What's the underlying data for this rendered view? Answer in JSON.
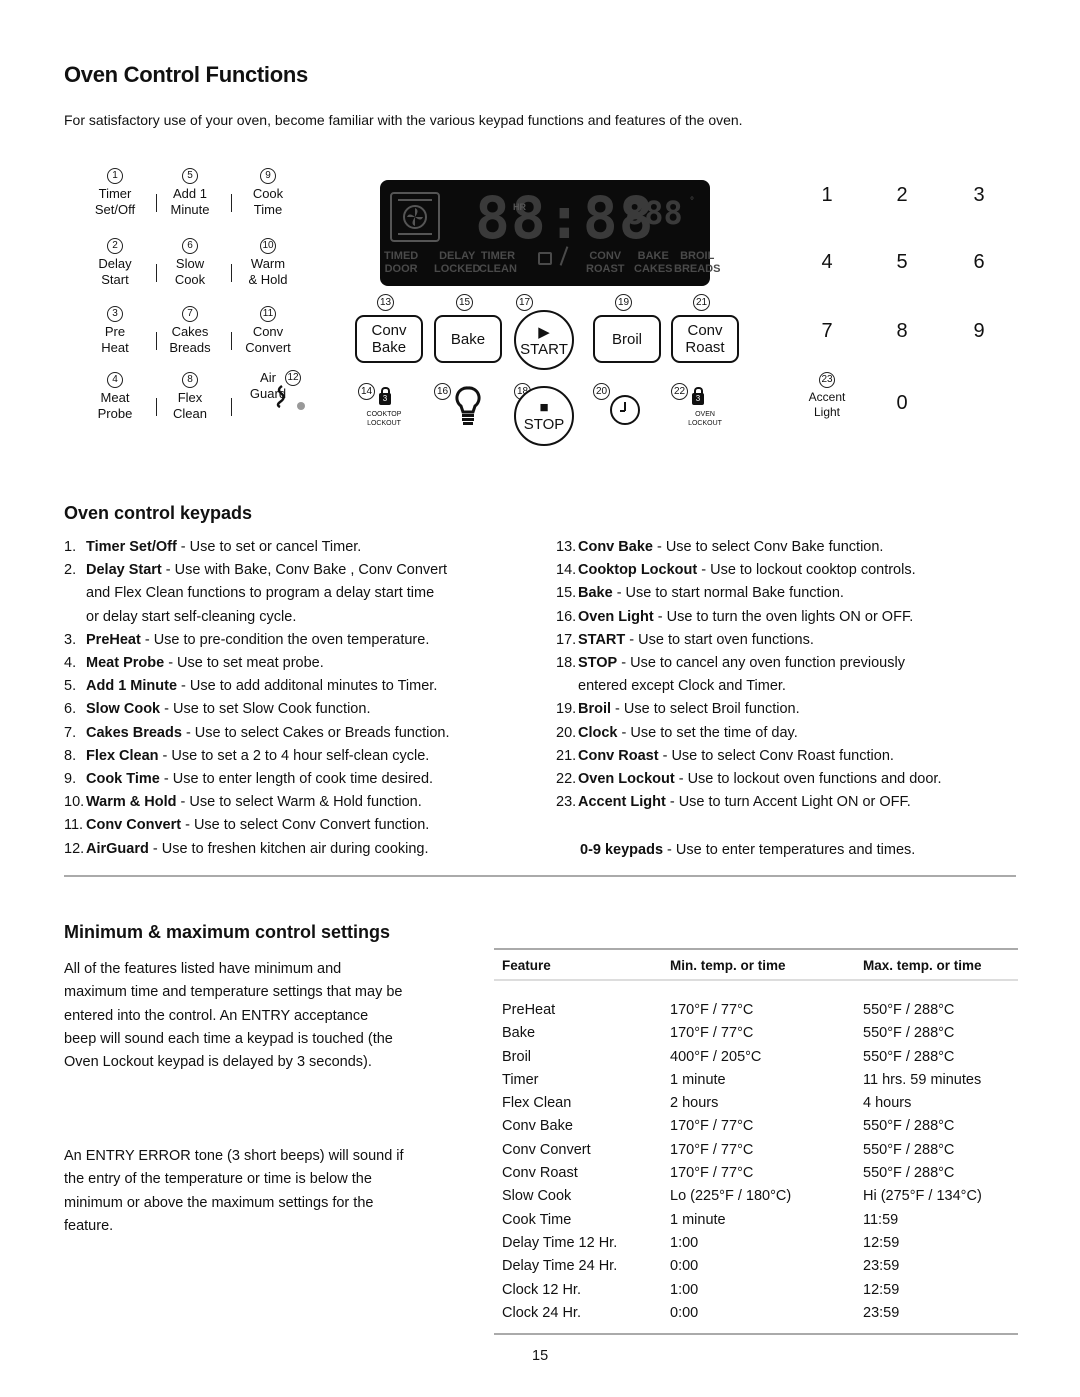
{
  "page": {
    "title": "Oven Control Functions",
    "intro": "For satisfactory use of your oven, become familiar with the various keypad functions and features of the oven.",
    "page_number": "15"
  },
  "panel": {
    "function_keys": [
      {
        "num": "1",
        "line1": "Timer",
        "line2": "Set/Off"
      },
      {
        "num": "5",
        "line1": "Add 1",
        "line2": "Minute"
      },
      {
        "num": "9",
        "line1": "Cook",
        "line2": "Time"
      },
      {
        "num": "2",
        "line1": "Delay",
        "line2": "Start"
      },
      {
        "num": "6",
        "line1": "Slow",
        "line2": "Cook"
      },
      {
        "num": "10",
        "line1": "Warm",
        "line2": "& Hold"
      },
      {
        "num": "3",
        "line1": "Pre",
        "line2": "Heat"
      },
      {
        "num": "7",
        "line1": "Cakes",
        "line2": "Breads"
      },
      {
        "num": "11",
        "line1": "Conv",
        "line2": "Convert"
      },
      {
        "num": "4",
        "line1": "Meat",
        "line2": "Probe"
      },
      {
        "num": "8",
        "line1": "Flex",
        "line2": "Clean"
      },
      {
        "num": "12",
        "line1": "Air",
        "line2": "Guard"
      }
    ],
    "display": {
      "clock_digits": "88:88",
      "hr_label": "HR",
      "temp_digits": "888",
      "degree": "°",
      "indicators_row1": [
        "TIMED",
        "DELAY",
        "TIMER",
        "CONV",
        "BAKE",
        "BROIL"
      ],
      "indicators_row2": [
        "DOOR",
        "LOCKED",
        "CLEAN",
        "ROAST",
        "CAKES",
        "BREADS"
      ]
    },
    "mode_buttons": [
      {
        "num": "13",
        "line1": "Conv",
        "line2": "Bake"
      },
      {
        "num": "15",
        "line1": "Bake",
        "line2": ""
      },
      {
        "num": "17",
        "line1": "▶",
        "line2": "START"
      },
      {
        "num": "19",
        "line1": "Broil",
        "line2": ""
      },
      {
        "num": "21",
        "line1": "Conv",
        "line2": "Roast"
      }
    ],
    "lower_buttons": [
      {
        "num": "14",
        "label1": "COOKTOP",
        "label2": "LOCKOUT",
        "icon": "lock-icon",
        "badge": "3"
      },
      {
        "num": "16",
        "icon": "light-bulb-icon"
      },
      {
        "num": "18",
        "line1": "■",
        "line2": "STOP"
      },
      {
        "num": "20",
        "icon": "clock-icon"
      },
      {
        "num": "22",
        "label1": "OVEN",
        "label2": "LOCKOUT",
        "icon": "lock-icon",
        "badge": "3"
      }
    ],
    "numpad": [
      "1",
      "2",
      "3",
      "4",
      "5",
      "6",
      "7",
      "8",
      "9",
      "0"
    ],
    "accent_light": {
      "num": "23",
      "line1": "Accent",
      "line2": "Light"
    }
  },
  "keypads_section": {
    "heading": "Oven control keypads",
    "left_items": [
      {
        "n": "1.",
        "name": "Timer Set/Off",
        "desc": " - Use to set or cancel Timer."
      },
      {
        "n": "2.",
        "name": "Delay Start",
        "desc": " - Use with Bake, Conv Bake , Conv Convert",
        "cont": [
          "and Flex Clean functions to program a delay start time",
          "or delay start self-cleaning cycle."
        ]
      },
      {
        "n": "3.",
        "name": "PreHeat",
        "desc": " - Use to pre-condition the oven temperature."
      },
      {
        "n": "4.",
        "name": "Meat Probe",
        "desc": " - Use to set meat probe."
      },
      {
        "n": "5.",
        "name": "Add 1 Minute",
        "desc": " - Use to add additonal minutes to Timer."
      },
      {
        "n": "6.",
        "name": "Slow Cook",
        "desc": " - Use to set Slow Cook  function."
      },
      {
        "n": "7.",
        "name": "Cakes Breads",
        "desc": " - Use to select Cakes or Breads function."
      },
      {
        "n": "8.",
        "name": "Flex Clean",
        "desc": " - Use to set a 2 to 4 hour self-clean cycle."
      },
      {
        "n": "9.",
        "name": "Cook Time",
        "desc": " - Use to enter length of cook time desired."
      },
      {
        "n": "10.",
        "name": "Warm & Hold",
        "desc": " - Use to select Warm & Hold function."
      },
      {
        "n": "11.",
        "name": "Conv Convert",
        "desc": " - Use to select Conv Convert function."
      },
      {
        "n": "12.",
        "name": "AirGuard",
        "desc": " - Use to freshen kitchen air during cooking."
      }
    ],
    "right_items": [
      {
        "n": "13.",
        "name": "Conv Bake",
        "desc": " - Use to select Conv Bake function."
      },
      {
        "n": "14.",
        "name": "Cooktop Lockout",
        "desc": " - Use to lockout cooktop controls."
      },
      {
        "n": "15.",
        "name": "Bake",
        "desc": " - Use to start normal Bake function."
      },
      {
        "n": "16.",
        "name": "Oven Light",
        "desc": " - Use to turn the oven lights ON or OFF."
      },
      {
        "n": "17.",
        "name": "START",
        "desc": " - Use to start oven functions."
      },
      {
        "n": "18.",
        "name": "STOP",
        "desc": " - Use to cancel any oven function previously",
        "cont": [
          "entered except Clock and Timer."
        ]
      },
      {
        "n": "19.",
        "name": "Broil",
        "desc": " - Use to select Broil function."
      },
      {
        "n": "20.",
        "name": "Clock",
        "desc": " - Use to set the time of day."
      },
      {
        "n": "21.",
        "name": "Conv Roast",
        "desc": " - Use to select Conv Roast function."
      },
      {
        "n": "22.",
        "name": "Oven Lockout",
        "desc": " - Use to lockout oven functions and door."
      },
      {
        "n": "23.",
        "name": "Accent Light",
        "desc": " -  Use to turn Accent Light ON or OFF."
      }
    ],
    "numpad_note": {
      "name": "0-9 keypads",
      "desc": " - Use to enter temperatures and times."
    }
  },
  "settings_section": {
    "heading": "Minimum & maximum control settings",
    "para1": "All of the features listed have minimum and maximum time and temperature settings that may be entered into the control.  An ENTRY acceptance beep will sound each time a keypad is touched (the Oven Lockout keypad is delayed by 3 seconds).",
    "para2": "An ENTRY ERROR tone (3 short beeps) will sound if the entry of the temperature or time is below the minimum or above the maximum settings for the feature.",
    "table": {
      "headers": [
        "Feature",
        "Min. temp. or time",
        "Max. temp. or time"
      ],
      "rows": [
        [
          "PreHeat",
          "170°F / 77°C",
          "550°F / 288°C"
        ],
        [
          "Bake",
          "170°F / 77°C",
          "550°F / 288°C"
        ],
        [
          "Broil",
          "400°F / 205°C",
          "550°F / 288°C"
        ],
        [
          "Timer",
          "1 minute",
          "11 hrs. 59 minutes"
        ],
        [
          "Flex Clean",
          "2 hours",
          "4 hours"
        ],
        [
          "Conv Bake",
          "170°F / 77°C",
          "550°F / 288°C"
        ],
        [
          "Conv Convert",
          "170°F / 77°C",
          "550°F / 288°C"
        ],
        [
          "Conv Roast",
          "170°F / 77°C",
          "550°F / 288°C"
        ],
        [
          "Slow Cook",
          "Lo (225°F / 180°C)",
          "Hi (275°F / 134°C)"
        ],
        [
          "Cook Time",
          "1 minute",
          "11:59"
        ],
        [
          "Delay Time 12 Hr.",
          "1:00",
          "12:59"
        ],
        [
          "Delay Time 24 Hr.",
          "0:00",
          "23:59"
        ],
        [
          "Clock 12 Hr.",
          "1:00",
          "12:59"
        ],
        [
          "Clock 24 Hr.",
          "0:00",
          "23:59"
        ]
      ]
    }
  }
}
